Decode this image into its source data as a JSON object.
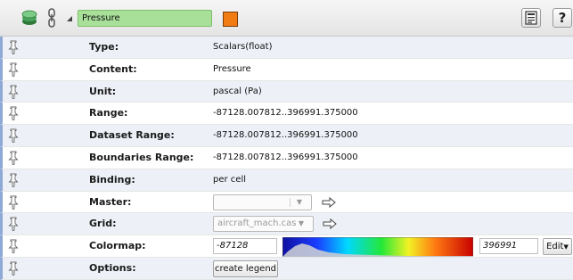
{
  "header": {
    "name_value": "Pressure",
    "swatch_color": "#f27c14"
  },
  "rows": [
    {
      "label": "Type:",
      "value": "Scalars(float)"
    },
    {
      "label": "Content:",
      "value": "Pressure"
    },
    {
      "label": "Unit:",
      "value": "pascal (Pa)"
    },
    {
      "label": "Range:",
      "value": "-87128.007812..396991.375000"
    },
    {
      "label": "Dataset Range:",
      "value": "-87128.007812..396991.375000"
    },
    {
      "label": "Boundaries Range:",
      "value": "-87128.007812..396991.375000"
    },
    {
      "label": "Binding:",
      "value": "per cell"
    },
    {
      "label": "Master:",
      "combo_value": ""
    },
    {
      "label": "Grid:",
      "combo_value": "aircraft_mach.cas"
    },
    {
      "label": "Colormap:",
      "min": "-87128",
      "max": "396991",
      "edit_label": "Edit"
    },
    {
      "label": "Options:",
      "button_label": "create legend"
    }
  ],
  "colors": {
    "row_alt": "#edf1f7",
    "accent_field": "#a8e09a"
  }
}
